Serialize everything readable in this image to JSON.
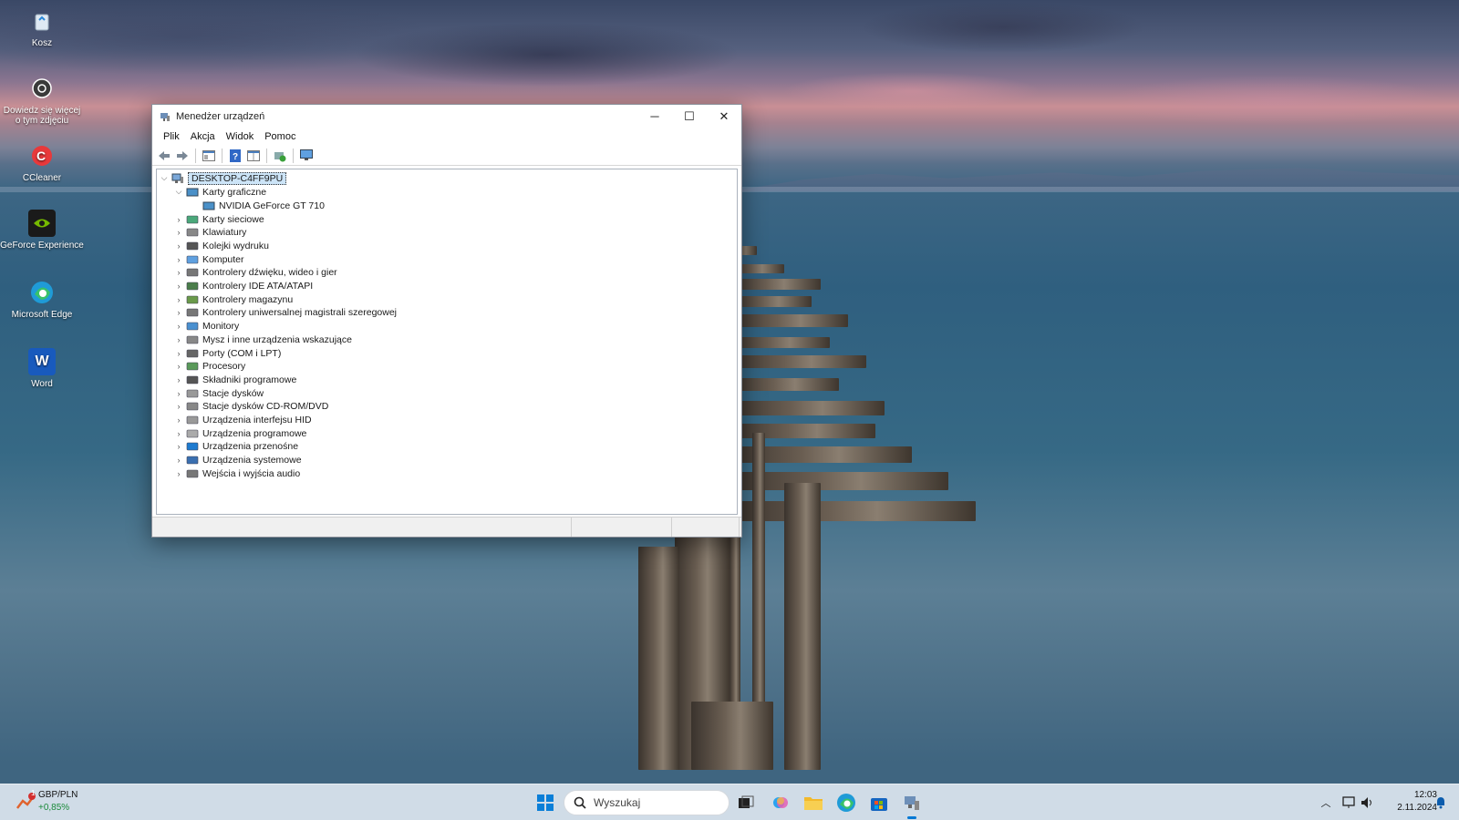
{
  "desktop": {
    "icons": [
      {
        "label": "Kosz",
        "icon": "recycle-bin-icon"
      },
      {
        "label": "Dowiedz się więcej o tym zdjęciu",
        "icon": "info-camera-icon"
      },
      {
        "label": "CCleaner",
        "icon": "ccleaner-icon"
      },
      {
        "label": "GeForce Experience",
        "icon": "nvidia-icon"
      },
      {
        "label": "Microsoft Edge",
        "icon": "edge-icon"
      },
      {
        "label": "Word",
        "icon": "word-icon"
      }
    ]
  },
  "window": {
    "title": "Menedżer urządzeń",
    "menu": [
      "Plik",
      "Akcja",
      "Widok",
      "Pomoc"
    ],
    "tree": {
      "root": "DESKTOP-C4FF9PU",
      "expanded_category": "Karty graficzne",
      "expanded_child": "NVIDIA GeForce GT 710",
      "categories": [
        "Karty sieciowe",
        "Klawiatury",
        "Kolejki wydruku",
        "Komputer",
        "Kontrolery dźwięku, wideo i gier",
        "Kontrolery IDE ATA/ATAPI",
        "Kontrolery magazynu",
        "Kontrolery uniwersalnej magistrali szeregowej",
        "Monitory",
        "Mysz i inne urządzenia wskazujące",
        "Porty (COM i LPT)",
        "Procesory",
        "Składniki programowe",
        "Stacje dysków",
        "Stacje dysków CD-ROM/DVD",
        "Urządzenia interfejsu HID",
        "Urządzenia programowe",
        "Urządzenia przenośne",
        "Urządzenia systemowe",
        "Wejścia i wyjścia audio"
      ]
    }
  },
  "taskbar": {
    "widget": {
      "badge": "1",
      "pair": "GBP/PLN",
      "change": "+0,85%"
    },
    "search_placeholder": "Wyszukaj",
    "time": "12:03",
    "date": "2.11.2024"
  },
  "colors": {
    "selection": "#cce4f7",
    "accent": "#0078d4"
  }
}
